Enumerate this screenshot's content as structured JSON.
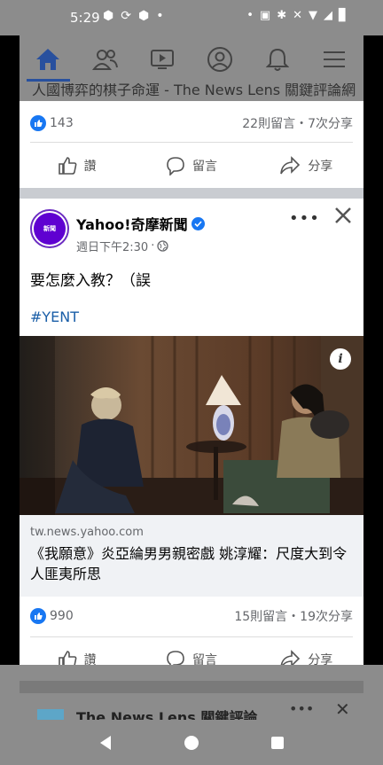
{
  "status_bar": {
    "time": "5:29",
    "left_icons": [
      "android-icon",
      "sync-icon",
      "android-icon",
      "dot-icon"
    ],
    "right_icons": [
      "dot-icon",
      "cast-icon",
      "bluetooth-icon",
      "mute-icon",
      "wifi-icon",
      "no-signal-icon",
      "battery-icon"
    ]
  },
  "top_nav": {
    "tabs": [
      {
        "name": "home",
        "active": true
      },
      {
        "name": "friends"
      },
      {
        "name": "watch"
      },
      {
        "name": "profile"
      },
      {
        "name": "notifications"
      },
      {
        "name": "menu"
      }
    ],
    "active_color": "#28509e"
  },
  "previous_post": {
    "link_title_fragment": "人國博弈的棋子命運 - The News Lens 關鍵評論網",
    "like_count": "143",
    "stats": "22則留言・7次分享"
  },
  "actions": {
    "like": "讚",
    "comment": "留言",
    "share": "分享"
  },
  "post": {
    "avatar_text": "新聞",
    "page_name": "Yahoo!奇摩新聞",
    "time": "週日下午2:30",
    "body": "要怎麼入教？（誤",
    "hashtag": "#YENT",
    "link_domain": "tw.news.yahoo.com",
    "link_title": "《我願意》炎亞綸男男親密戲 姚淳耀：尺度大到令人匪夷所思",
    "like_count": "990",
    "stats": "15則留言・19次分享",
    "more_label": "•••",
    "info_label": "i"
  },
  "next_post": {
    "page_name": "The News Lens 關鍵評論",
    "more_label": "•••"
  },
  "colors": {
    "facebook_blue": "#1877f2",
    "hashtag": "#1b5fa8",
    "dim_overlay": "#8c8c8c"
  }
}
